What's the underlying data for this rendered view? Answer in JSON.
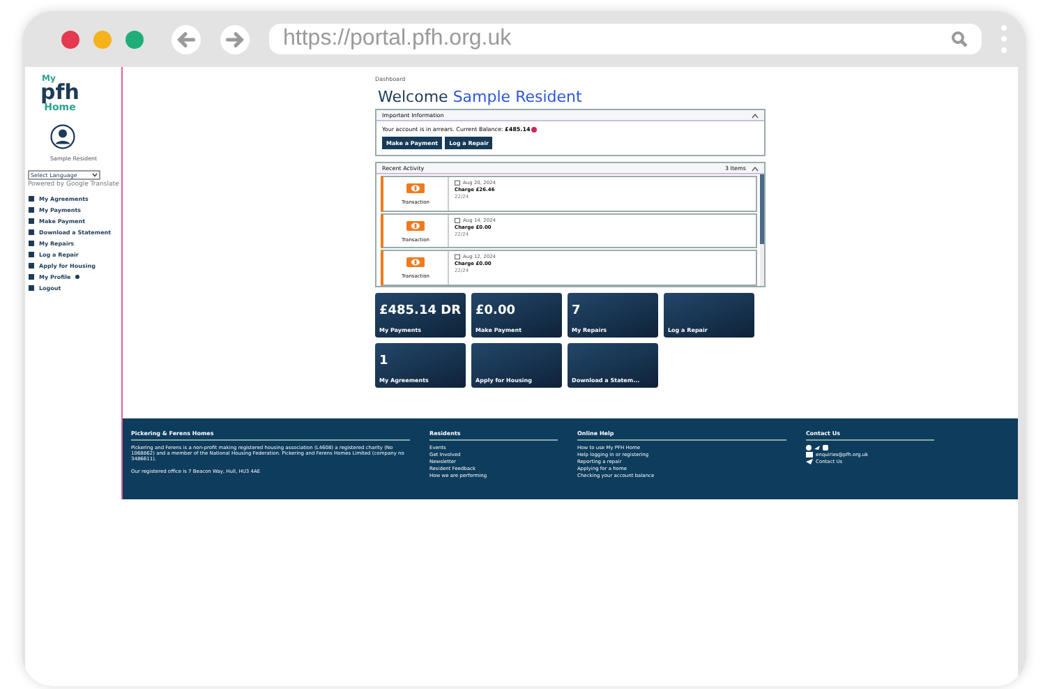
{
  "browser": {
    "url": "https://portal.pfh.org.uk"
  },
  "sidebar": {
    "logo": {
      "top": "My",
      "main": "pfh",
      "bottom": "Home"
    },
    "user_name": "Sample Resident",
    "language_select": {
      "value": "Select Language"
    },
    "translate_note": "Powered by Google Translate",
    "items": [
      {
        "label": "My Agreements",
        "badge": false
      },
      {
        "label": "My Payments",
        "badge": false
      },
      {
        "label": "Make Payment",
        "badge": false
      },
      {
        "label": "Download a Statement",
        "badge": false
      },
      {
        "label": "My Repairs",
        "badge": false
      },
      {
        "label": "Log a Repair",
        "badge": false
      },
      {
        "label": "Apply for Housing",
        "badge": false
      },
      {
        "label": "My Profile",
        "badge": true
      },
      {
        "label": "Logout",
        "badge": false
      }
    ]
  },
  "breadcrumb": "Dashboard",
  "welcome": {
    "greeting": "Welcome",
    "name": "Sample Resident"
  },
  "important_panel": {
    "title": "Important Information",
    "expanded": true,
    "message": "Your account is in arrears. Current Balance: **£485.14**",
    "alert": true,
    "buttons": [
      "Make a Payment",
      "Log a Repair"
    ]
  },
  "activity_panel": {
    "title": "Recent Activity",
    "count": "3 Items",
    "expanded": true,
    "items": [
      {
        "type": "Transaction",
        "date": "Aug 20, 2024",
        "title": "Charge £26.46",
        "detail": "22/24"
      },
      {
        "type": "Transaction",
        "date": "Aug 14, 2024",
        "title": "Charge £0.00",
        "detail": "22/24"
      },
      {
        "type": "Transaction",
        "date": "Aug 12, 2024",
        "title": "Charge £0.00",
        "detail": "22/24"
      }
    ]
  },
  "tiles": [
    {
      "value": "£485.14 DR",
      "label": "My Payments"
    },
    {
      "value": "£0.00",
      "label": "Make Payment"
    },
    {
      "value": "7",
      "label": "My Repairs"
    },
    {
      "label": "Log a Repair"
    },
    {
      "value": "1",
      "label": "My Agreements"
    },
    {
      "label": "Apply for Housing"
    },
    {
      "label": "Download a Statem..."
    }
  ],
  "footer": {
    "about": {
      "title": "Pickering & Ferens Homes",
      "text": "Pickering and Ferens is a non-profit making registered housing association (L4608) a registered charity (No 1068862) and a member of the National Housing Federation. Pickering and Ferens Homes Limited (company no 3486611).",
      "office": "Our registered office is 7 Beacon Way, Hull, HU3 4AE"
    },
    "residents": {
      "title": "Residents",
      "links": [
        "Events",
        "Get Involved",
        "Newsletter",
        "Resident Feedback",
        "How we are performing"
      ]
    },
    "help": {
      "title": "Online Help",
      "links": [
        "How to use My PFH Home",
        "Help logging in or registering",
        "Reporting a repair",
        "Applying for a home",
        "Checking your account balance"
      ]
    },
    "contact": {
      "title": "Contact Us",
      "email": "enquiries@pfh.org.uk",
      "link": "Contact Us"
    }
  }
}
